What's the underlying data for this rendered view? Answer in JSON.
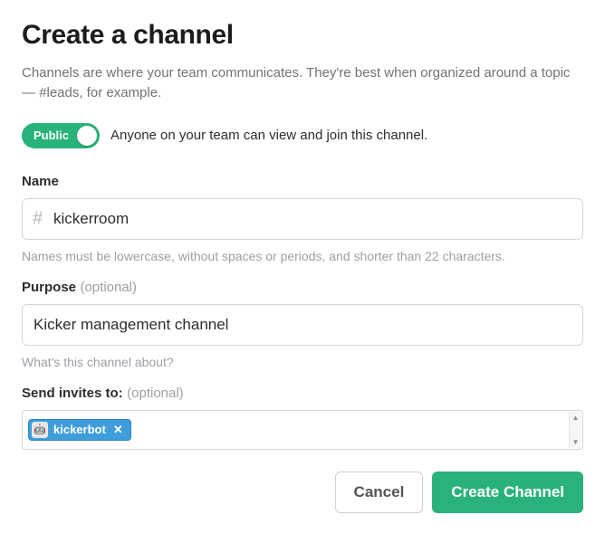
{
  "title": "Create a channel",
  "description": "Channels are where your team communicates. They're best when organized around a topic — #leads, for example.",
  "privacy": {
    "toggle_label": "Public",
    "description": "Anyone on your team can view and join this channel."
  },
  "name": {
    "label": "Name",
    "prefix": "#",
    "value": "kickerroom",
    "help": "Names must be lowercase, without spaces or periods, and shorter than 22 characters."
  },
  "purpose": {
    "label": "Purpose",
    "optional_text": "(optional)",
    "value": "Kicker management channel",
    "help": "What's this channel about?"
  },
  "invites": {
    "label": "Send invites to:",
    "optional_text": "(optional)",
    "chips": [
      {
        "name": "kickerbot",
        "avatar_emoji": "🤖"
      }
    ]
  },
  "buttons": {
    "cancel": "Cancel",
    "create": "Create Channel"
  }
}
